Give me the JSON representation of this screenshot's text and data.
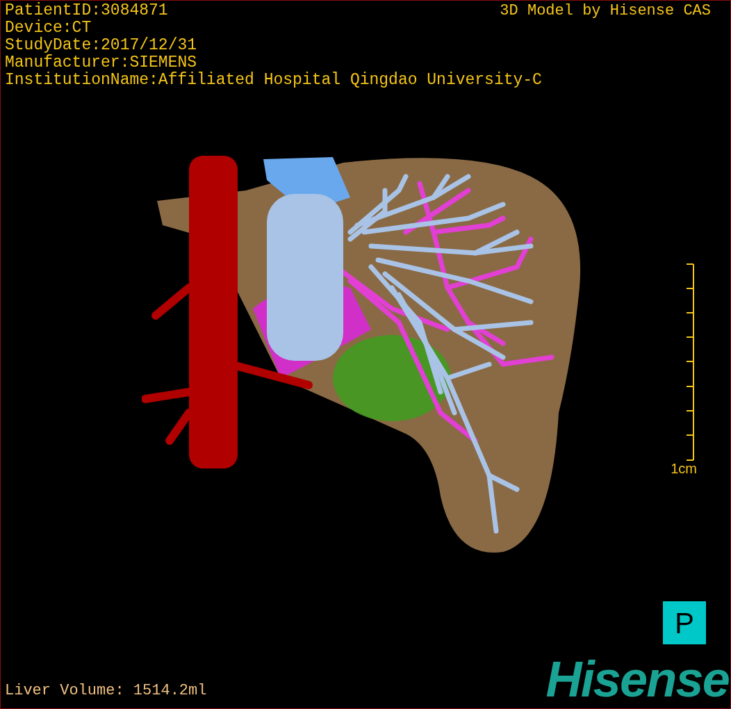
{
  "viewer": {
    "patient_info": [
      "PatientID:3084871",
      "Device:CT",
      "StudyDate:2017/12/31",
      "Manufacturer:SIEMENS",
      "InstitutionName:Affiliated Hospital Qingdao University-C"
    ],
    "model_credit": "3D Model by Hisense CAS",
    "scale_bar": {
      "label": "1cm"
    },
    "orientation_marker": "P",
    "liver_volume": "Liver Volume: 1514.2ml",
    "logo": "Hisense"
  }
}
